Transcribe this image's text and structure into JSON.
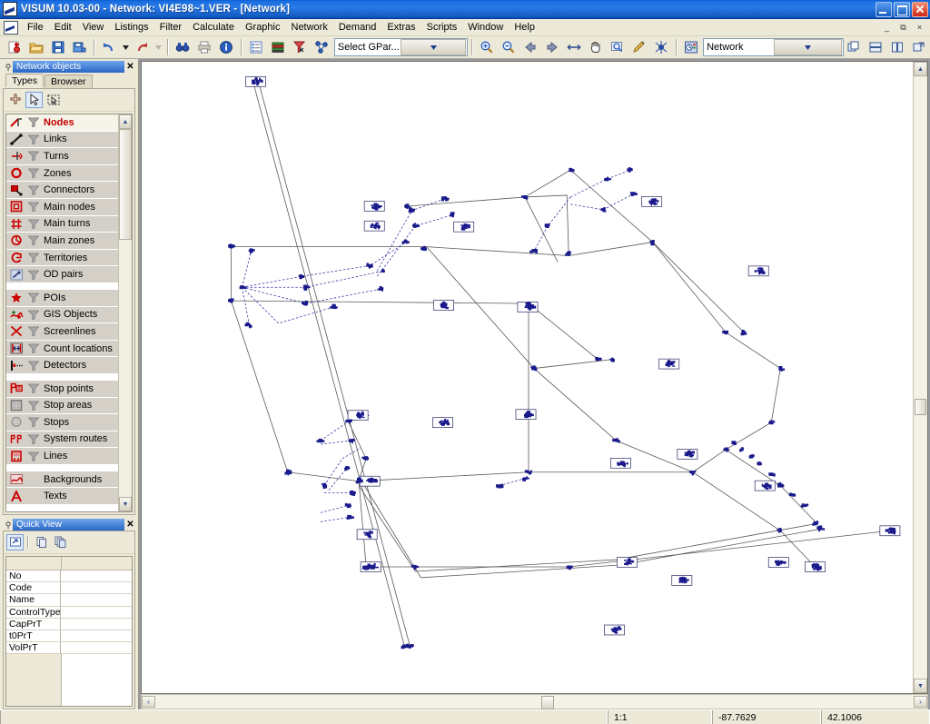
{
  "window": {
    "title": "VISUM 10.03-00 - Network: VI4E98~1.VER - [Network]",
    "app_icon": "visum-icon",
    "minimize": "–",
    "restore": "❐",
    "close": "✕"
  },
  "menubar": {
    "items": [
      {
        "label": "File"
      },
      {
        "label": "Edit"
      },
      {
        "label": "View"
      },
      {
        "label": "Listings"
      },
      {
        "label": "Filter"
      },
      {
        "label": "Calculate"
      },
      {
        "label": "Graphic"
      },
      {
        "label": "Network"
      },
      {
        "label": "Demand"
      },
      {
        "label": "Extras"
      },
      {
        "label": "Scripts"
      },
      {
        "label": "Window"
      },
      {
        "label": "Help"
      }
    ],
    "mdi": {
      "minimize": "_",
      "restore": "⧉",
      "close": "×"
    }
  },
  "toolbar": {
    "group1": [
      {
        "name": "new-version-icon",
        "title": "New"
      },
      {
        "name": "open-folder-icon",
        "title": "Open"
      },
      {
        "name": "save-icon",
        "title": "Save"
      },
      {
        "name": "save-as-icon",
        "title": "Save as"
      }
    ],
    "group2": [
      {
        "name": "undo-icon",
        "title": "Undo"
      },
      {
        "name": "undo-dropdown-icon",
        "title": "Undo list"
      },
      {
        "name": "redo-icon",
        "title": "Redo"
      }
    ],
    "group3": [
      {
        "name": "find-binoculars-icon",
        "title": "Find"
      },
      {
        "name": "print-icon",
        "title": "Print"
      },
      {
        "name": "info-icon",
        "title": "Info"
      }
    ],
    "group4": [
      {
        "name": "list-icon",
        "title": "Lists"
      },
      {
        "name": "graphic-parameters-icon",
        "title": "Graphic parameters"
      },
      {
        "name": "filter-icon",
        "title": "Filter"
      },
      {
        "name": "network-settings-icon",
        "title": "Network settings"
      }
    ],
    "gpar_select": {
      "value": "Select GPar...",
      "caret": "▼"
    },
    "group5": [
      {
        "name": "zoom-in-icon",
        "title": "Zoom in"
      },
      {
        "name": "zoom-out-icon",
        "title": "Zoom out"
      },
      {
        "name": "back-arrow-icon",
        "title": "Previous view"
      },
      {
        "name": "forward-arrow-icon",
        "title": "Next view"
      },
      {
        "name": "fit-width-icon",
        "title": "Zoom to fit"
      },
      {
        "name": "pan-hand-icon",
        "title": "Pan"
      },
      {
        "name": "zoom-window-icon",
        "title": "Zoom window"
      },
      {
        "name": "edit-pencil-icon",
        "title": "Edit graphics"
      },
      {
        "name": "spider-icon",
        "title": "Flow bundle"
      }
    ],
    "network_select": {
      "icon": "network-clock-icon",
      "value": "Network",
      "caret": "▼"
    },
    "group6": [
      {
        "name": "tile-windows-icon",
        "title": "Tile"
      },
      {
        "name": "tile-horizontal-icon",
        "title": "Tile horizontally"
      },
      {
        "name": "tile-vertical-icon",
        "title": "Tile vertically"
      },
      {
        "name": "new-window-icon",
        "title": "New window"
      }
    ]
  },
  "network_objects_panel": {
    "pin": "⚲",
    "title": "Network objects",
    "close": "✕",
    "tabs": [
      {
        "label": "Types",
        "active": true
      },
      {
        "label": "Browser",
        "active": false
      }
    ],
    "tools": [
      {
        "name": "insert-mode-icon",
        "pressed": false
      },
      {
        "name": "select-arrow-icon",
        "pressed": true
      },
      {
        "name": "multi-select-icon",
        "pressed": false
      }
    ],
    "items": [
      {
        "label": "Nodes",
        "icon": "nodes-icon",
        "selected": true,
        "filter": true
      },
      {
        "label": "Links",
        "icon": "links-icon",
        "selected": false,
        "filter": true
      },
      {
        "label": "Turns",
        "icon": "turns-icon",
        "selected": false,
        "filter": true
      },
      {
        "label": "Zones",
        "icon": "zones-icon",
        "selected": false,
        "filter": true
      },
      {
        "label": "Connectors",
        "icon": "connectors-icon",
        "selected": false,
        "filter": true
      },
      {
        "label": "Main nodes",
        "icon": "main-nodes-icon",
        "selected": false,
        "filter": true
      },
      {
        "label": "Main turns",
        "icon": "main-turns-icon",
        "selected": false,
        "filter": true
      },
      {
        "label": "Main zones",
        "icon": "main-zones-icon",
        "selected": false,
        "filter": true
      },
      {
        "label": "Territories",
        "icon": "territories-icon",
        "selected": false,
        "filter": true
      },
      {
        "label": "OD pairs",
        "icon": "od-pairs-icon",
        "selected": false,
        "filter": true
      },
      {
        "label": "",
        "icon": "separator",
        "separator": true
      },
      {
        "label": "POIs",
        "icon": "pois-star-icon",
        "selected": false,
        "filter": true
      },
      {
        "label": "GIS Objects",
        "icon": "gis-objects-icon",
        "selected": false,
        "filter": true
      },
      {
        "label": "Screenlines",
        "icon": "screenlines-icon",
        "selected": false,
        "filter": true
      },
      {
        "label": "Count locations",
        "icon": "count-locations-icon",
        "selected": false,
        "filter": true
      },
      {
        "label": "Detectors",
        "icon": "detectors-icon",
        "selected": false,
        "filter": true
      },
      {
        "label": "",
        "icon": "separator",
        "separator": true
      },
      {
        "label": "Stop points",
        "icon": "stop-points-icon",
        "selected": false,
        "filter": true
      },
      {
        "label": "Stop areas",
        "icon": "stop-areas-icon",
        "selected": false,
        "filter": true
      },
      {
        "label": "Stops",
        "icon": "stops-icon",
        "selected": false,
        "filter": true
      },
      {
        "label": "System routes",
        "icon": "system-routes-icon",
        "selected": false,
        "filter": true
      },
      {
        "label": "Lines",
        "icon": "lines-icon",
        "selected": false,
        "filter": true
      },
      {
        "label": "",
        "icon": "separator",
        "separator": true
      },
      {
        "label": "Backgrounds",
        "icon": "backgrounds-icon",
        "selected": false,
        "filter": false
      },
      {
        "label": "Texts",
        "icon": "texts-icon",
        "selected": false,
        "filter": false
      }
    ],
    "scroll": {
      "up": "▲",
      "down": "▼"
    }
  },
  "quick_view_panel": {
    "pin": "⚲",
    "title": "Quick View",
    "close": "✕",
    "tools": [
      {
        "name": "quickview-select-icon"
      },
      {
        "name": "copy-icon"
      },
      {
        "name": "copy-all-icon"
      }
    ],
    "rows": [
      {
        "key": "No",
        "value": ""
      },
      {
        "key": "Code",
        "value": ""
      },
      {
        "key": "Name",
        "value": ""
      },
      {
        "key": "ControlType",
        "value": ""
      },
      {
        "key": "CapPrT",
        "value": ""
      },
      {
        "key": "t0PrT",
        "value": ""
      },
      {
        "key": "VolPrT",
        "value": ""
      }
    ]
  },
  "map": {
    "hscroll": {
      "left": "‹",
      "right": "›"
    },
    "vscroll": {
      "up": "▲",
      "down": "▼"
    },
    "colors": {
      "node": "#1a1a8c",
      "link": "#5a5a5a",
      "connector": "#3a3aa8",
      "background": "#ffffff"
    }
  },
  "statusbar": {
    "message": "",
    "scale": "1:1",
    "x_coordinate": "-87.7629",
    "y_coordinate": "42.1006"
  }
}
